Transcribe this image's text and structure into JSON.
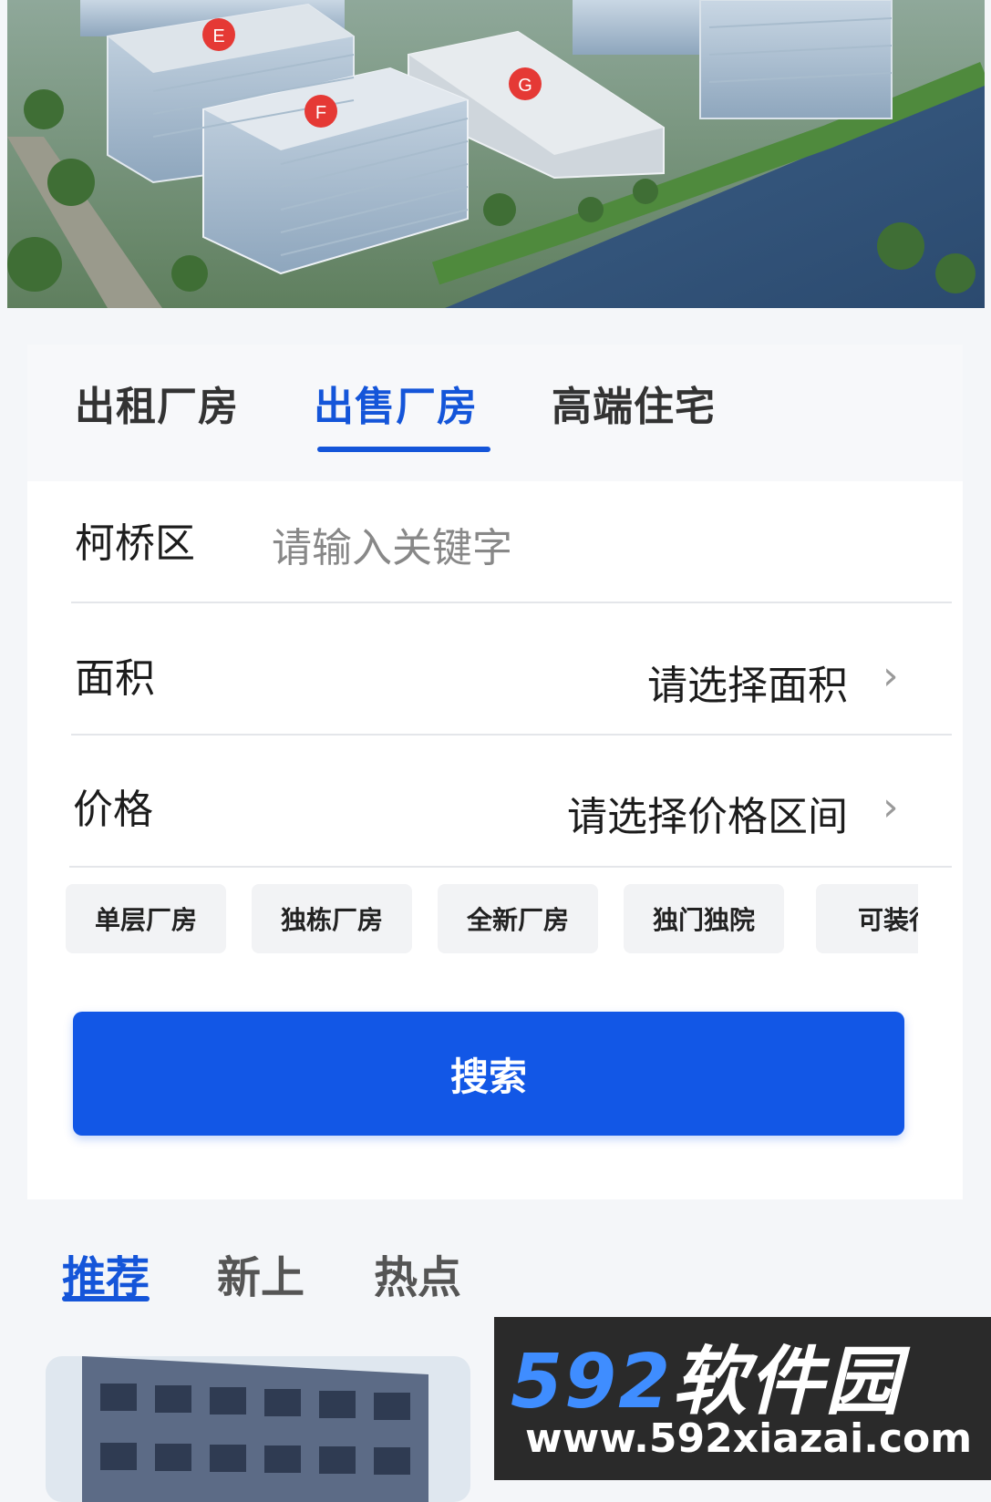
{
  "hero": {
    "building_markers": [
      "E",
      "F",
      "G"
    ]
  },
  "main_tabs": [
    {
      "label": "出租厂房",
      "active": false
    },
    {
      "label": "出售厂房",
      "active": true
    },
    {
      "label": "高端住宅",
      "active": false
    }
  ],
  "search_form": {
    "district": "柯桥区",
    "keyword_placeholder": "请输入关键字",
    "area_label": "面积",
    "area_value": "请选择面积",
    "price_label": "价格",
    "price_value": "请选择价格区间"
  },
  "tags": [
    "单层厂房",
    "独栋厂房",
    "全新厂房",
    "独门独院",
    "可装行"
  ],
  "search_button": "搜索",
  "sub_tabs": [
    {
      "label": "推荐",
      "active": true
    },
    {
      "label": "新上",
      "active": false
    },
    {
      "label": "热点",
      "active": false
    }
  ],
  "watermark": {
    "brand_number": "592",
    "brand_text": "软件园",
    "url": "www.592xiazai.com"
  },
  "colors": {
    "accent": "#1455d9",
    "button": "#1257e6",
    "page_bg": "#f4f6f9"
  },
  "icons": {
    "chevron": "chevron-right-icon"
  }
}
